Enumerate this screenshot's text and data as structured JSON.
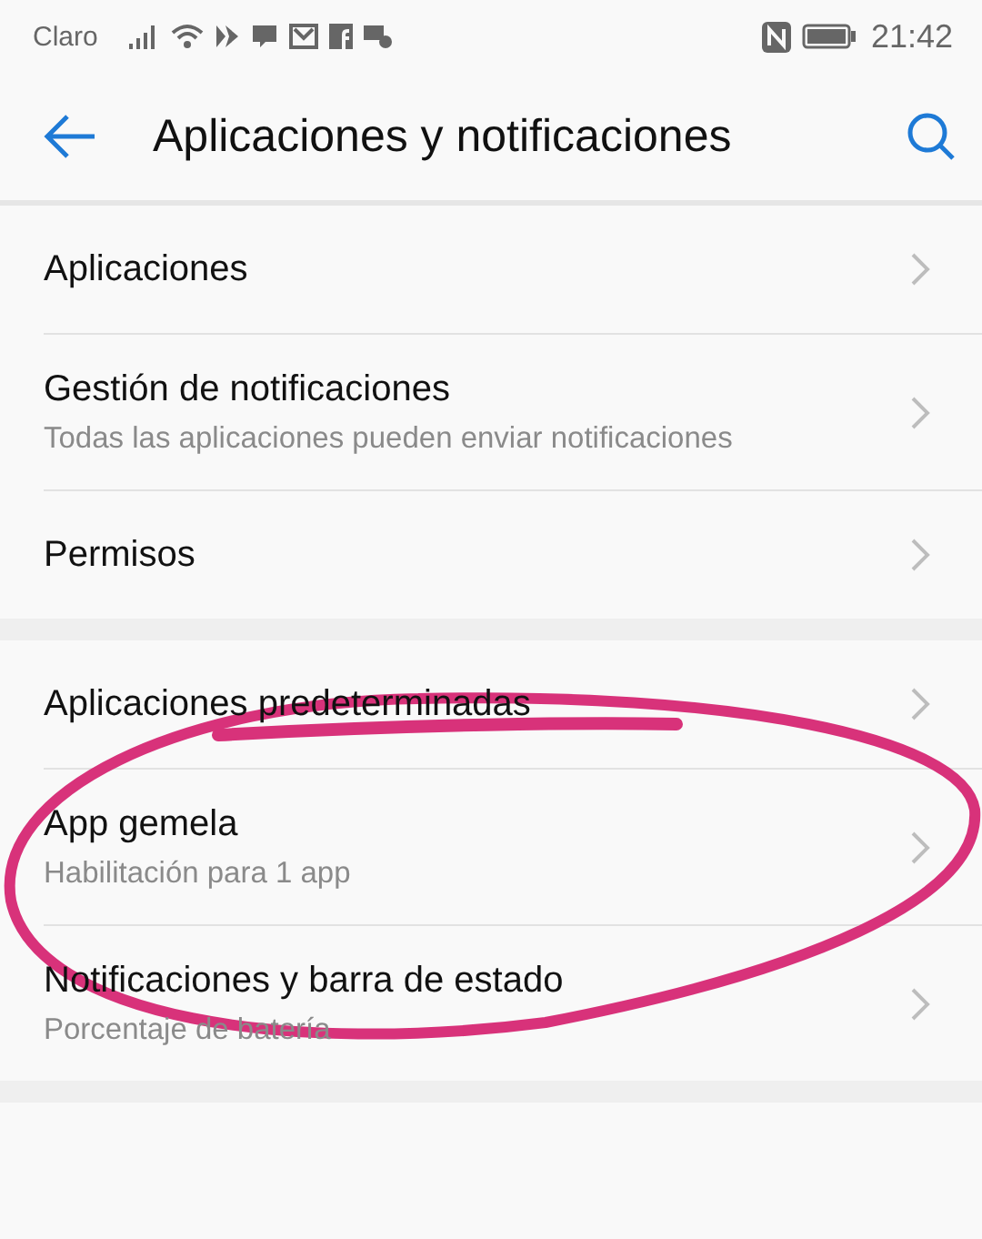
{
  "status_bar": {
    "carrier": "Claro",
    "time": "21:42"
  },
  "header": {
    "title": "Aplicaciones y notificaciones"
  },
  "sections": [
    {
      "items": [
        {
          "title": "Aplicaciones"
        },
        {
          "title": "Gestión de notificaciones",
          "subtitle": "Todas las aplicaciones pueden enviar notificaciones"
        },
        {
          "title": "Permisos"
        }
      ]
    },
    {
      "items": [
        {
          "title": "Aplicaciones predeterminadas"
        },
        {
          "title": "App gemela",
          "subtitle": "Habilitación para 1 app"
        },
        {
          "title": "Notificaciones y barra de estado",
          "subtitle": "Porcentaje de batería"
        }
      ]
    }
  ]
}
